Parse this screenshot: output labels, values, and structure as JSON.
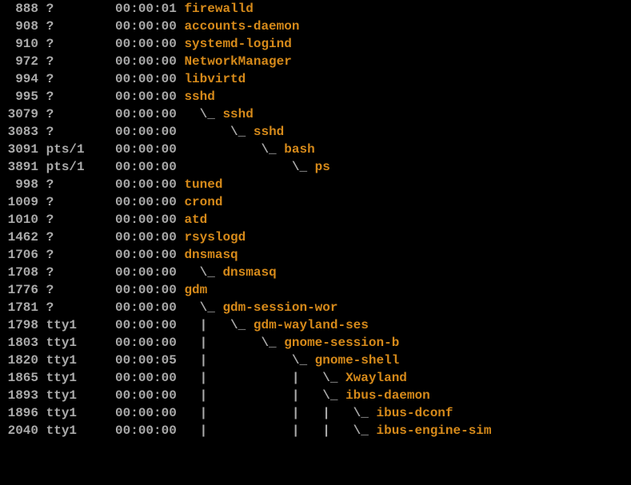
{
  "colors": {
    "grey": "#aaa",
    "orange": "#d68a1a",
    "bg": "#000"
  },
  "rows": [
    {
      "pid": "888",
      "tty": "?",
      "time": "00:00:01",
      "cmd_prefix": "",
      "cmd": "firewalld"
    },
    {
      "pid": "908",
      "tty": "?",
      "time": "00:00:00",
      "cmd_prefix": "",
      "cmd": "accounts-daemon"
    },
    {
      "pid": "910",
      "tty": "?",
      "time": "00:00:00",
      "cmd_prefix": "",
      "cmd": "systemd-logind"
    },
    {
      "pid": "972",
      "tty": "?",
      "time": "00:00:00",
      "cmd_prefix": "",
      "cmd": "NetworkManager"
    },
    {
      "pid": "994",
      "tty": "?",
      "time": "00:00:00",
      "cmd_prefix": "",
      "cmd": "libvirtd"
    },
    {
      "pid": "995",
      "tty": "?",
      "time": "00:00:00",
      "cmd_prefix": "",
      "cmd": "sshd"
    },
    {
      "pid": "3079",
      "tty": "?",
      "time": "00:00:00",
      "cmd_prefix": "  \\_ ",
      "cmd": "sshd"
    },
    {
      "pid": "3083",
      "tty": "?",
      "time": "00:00:00",
      "cmd_prefix": "      \\_ ",
      "cmd": "sshd"
    },
    {
      "pid": "3091",
      "tty": "pts/1",
      "time": "00:00:00",
      "cmd_prefix": "          \\_ ",
      "cmd": "bash"
    },
    {
      "pid": "3891",
      "tty": "pts/1",
      "time": "00:00:00",
      "cmd_prefix": "              \\_ ",
      "cmd": "ps"
    },
    {
      "pid": "998",
      "tty": "?",
      "time": "00:00:00",
      "cmd_prefix": "",
      "cmd": "tuned"
    },
    {
      "pid": "1009",
      "tty": "?",
      "time": "00:00:00",
      "cmd_prefix": "",
      "cmd": "crond"
    },
    {
      "pid": "1010",
      "tty": "?",
      "time": "00:00:00",
      "cmd_prefix": "",
      "cmd": "atd"
    },
    {
      "pid": "1462",
      "tty": "?",
      "time": "00:00:00",
      "cmd_prefix": "",
      "cmd": "rsyslogd"
    },
    {
      "pid": "1706",
      "tty": "?",
      "time": "00:00:00",
      "cmd_prefix": "",
      "cmd": "dnsmasq"
    },
    {
      "pid": "1708",
      "tty": "?",
      "time": "00:00:00",
      "cmd_prefix": "  \\_ ",
      "cmd": "dnsmasq"
    },
    {
      "pid": "1776",
      "tty": "?",
      "time": "00:00:00",
      "cmd_prefix": "",
      "cmd": "gdm"
    },
    {
      "pid": "1781",
      "tty": "?",
      "time": "00:00:00",
      "cmd_prefix": "  \\_ ",
      "cmd": "gdm-session-wor"
    },
    {
      "pid": "1798",
      "tty": "tty1",
      "time": "00:00:00",
      "cmd_prefix": "  |   \\_ ",
      "cmd": "gdm-wayland-ses"
    },
    {
      "pid": "1803",
      "tty": "tty1",
      "time": "00:00:00",
      "cmd_prefix": "  |       \\_ ",
      "cmd": "gnome-session-b"
    },
    {
      "pid": "1820",
      "tty": "tty1",
      "time": "00:00:05",
      "cmd_prefix": "  |           \\_ ",
      "cmd": "gnome-shell"
    },
    {
      "pid": "1865",
      "tty": "tty1",
      "time": "00:00:00",
      "cmd_prefix": "  |           |   \\_ ",
      "cmd": "Xwayland"
    },
    {
      "pid": "1893",
      "tty": "tty1",
      "time": "00:00:00",
      "cmd_prefix": "  |           |   \\_ ",
      "cmd": "ibus-daemon"
    },
    {
      "pid": "1896",
      "tty": "tty1",
      "time": "00:00:00",
      "cmd_prefix": "  |           |   |   \\_ ",
      "cmd": "ibus-dconf"
    },
    {
      "pid": "2040",
      "tty": "tty1",
      "time": "00:00:00",
      "cmd_prefix": "  |           |   |   \\_ ",
      "cmd": "ibus-engine-sim"
    }
  ]
}
